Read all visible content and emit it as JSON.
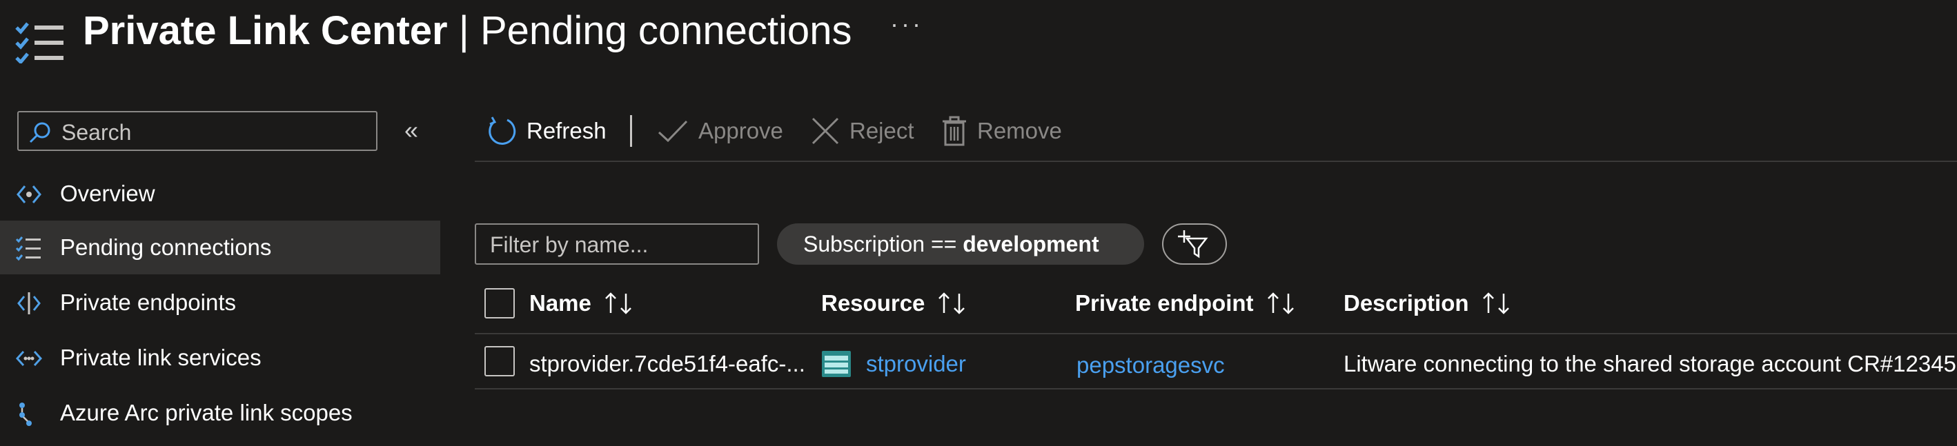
{
  "header": {
    "title_main": "Private Link Center",
    "title_sep": " | ",
    "title_sub": "Pending connections",
    "more_label": "···",
    "icon": "checklist-icon"
  },
  "sidebar": {
    "search_placeholder": "Search",
    "collapse_label": "«",
    "items": [
      {
        "label": "Overview",
        "icon": "overview-icon",
        "active": false
      },
      {
        "label": "Pending connections",
        "icon": "checklist-icon",
        "active": true
      },
      {
        "label": "Private endpoints",
        "icon": "private-endpoint-icon",
        "active": false
      },
      {
        "label": "Private link services",
        "icon": "private-link-service-icon",
        "active": false
      },
      {
        "label": "Azure Arc private link scopes",
        "icon": "arc-scope-icon",
        "active": false
      }
    ]
  },
  "toolbar": {
    "refresh": "Refresh",
    "approve": "Approve",
    "reject": "Reject",
    "remove": "Remove"
  },
  "filters": {
    "name_placeholder": "Filter by name...",
    "subscription_prefix": "Subscription == ",
    "subscription_value": "development"
  },
  "table": {
    "headers": {
      "name": "Name",
      "resource": "Resource",
      "private_endpoint": "Private endpoint",
      "description": "Description"
    },
    "rows": [
      {
        "name": "stprovider.7cde51f4-eafc-...",
        "resource": "stprovider",
        "private_endpoint": "pepstoragesvc",
        "description": "Litware connecting to the shared storage account CR#12345"
      }
    ]
  },
  "colors": {
    "background": "#1b1a19",
    "active_nav": "#323130",
    "accent": "#4aa0f0",
    "disabled": "#8a8886"
  }
}
